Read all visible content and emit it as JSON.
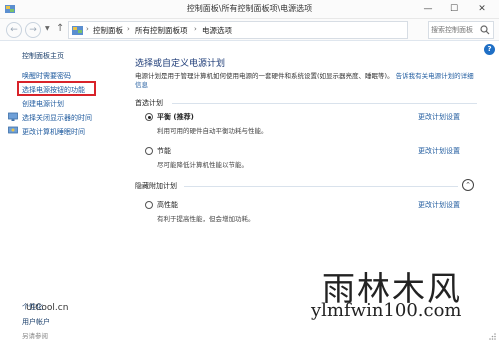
{
  "window": {
    "title": "控制面板\\所有控制面板项\\电源选项",
    "controls": {
      "minimize": "—",
      "maximize": "☐",
      "close": "✕"
    }
  },
  "address_bar": {
    "back": "←",
    "forward": "→",
    "up": "↑",
    "breadcrumbs": [
      "控制面板",
      "所有控制面板项",
      "电源选项"
    ],
    "separator": "›",
    "search_placeholder": "搜索控制面板"
  },
  "sidebar": {
    "home": "控制面板主页",
    "items": [
      {
        "label": "唤醒时需要密码"
      },
      {
        "label": "选择电源按钮的功能",
        "highlighted": true
      },
      {
        "label": "创建电源计划"
      },
      {
        "label": "选择关闭显示器的时间",
        "icon": "monitor-power-icon"
      },
      {
        "label": "更改计算机睡眠时间",
        "icon": "sleep-icon"
      }
    ],
    "brand": "UiCool.cn",
    "see_also": {
      "heading": "另请参阅",
      "items": [
        "个性化",
        "用户帐户"
      ]
    }
  },
  "main": {
    "title": "选择或自定义电源计划",
    "description": "电源计划是用于管理计算机如何使用电源的一套硬件和系统设置(如显示器亮度、睡眠等)。",
    "description_link": "告诉我有关电源计划的详细信息",
    "preferred_section": "首选计划",
    "hidden_section": "隐藏附加计划",
    "change_link": "更改计划设置",
    "plans": [
      {
        "name": "平衡 (推荐)",
        "desc": "利用可用的硬件自动平衡功耗与性能。",
        "selected": true
      },
      {
        "name": "节能",
        "desc": "尽可能降低计算机性能以节能。",
        "selected": false
      },
      {
        "name": "高性能",
        "desc": "有利于提高性能，但会增加功耗。",
        "selected": false
      }
    ]
  },
  "watermark": {
    "name": "雨林木风",
    "url": "ylmfwin100.com"
  },
  "colors": {
    "link": "#1e5a9e",
    "title": "#1e3c78",
    "highlight_box": "#d8232a"
  }
}
